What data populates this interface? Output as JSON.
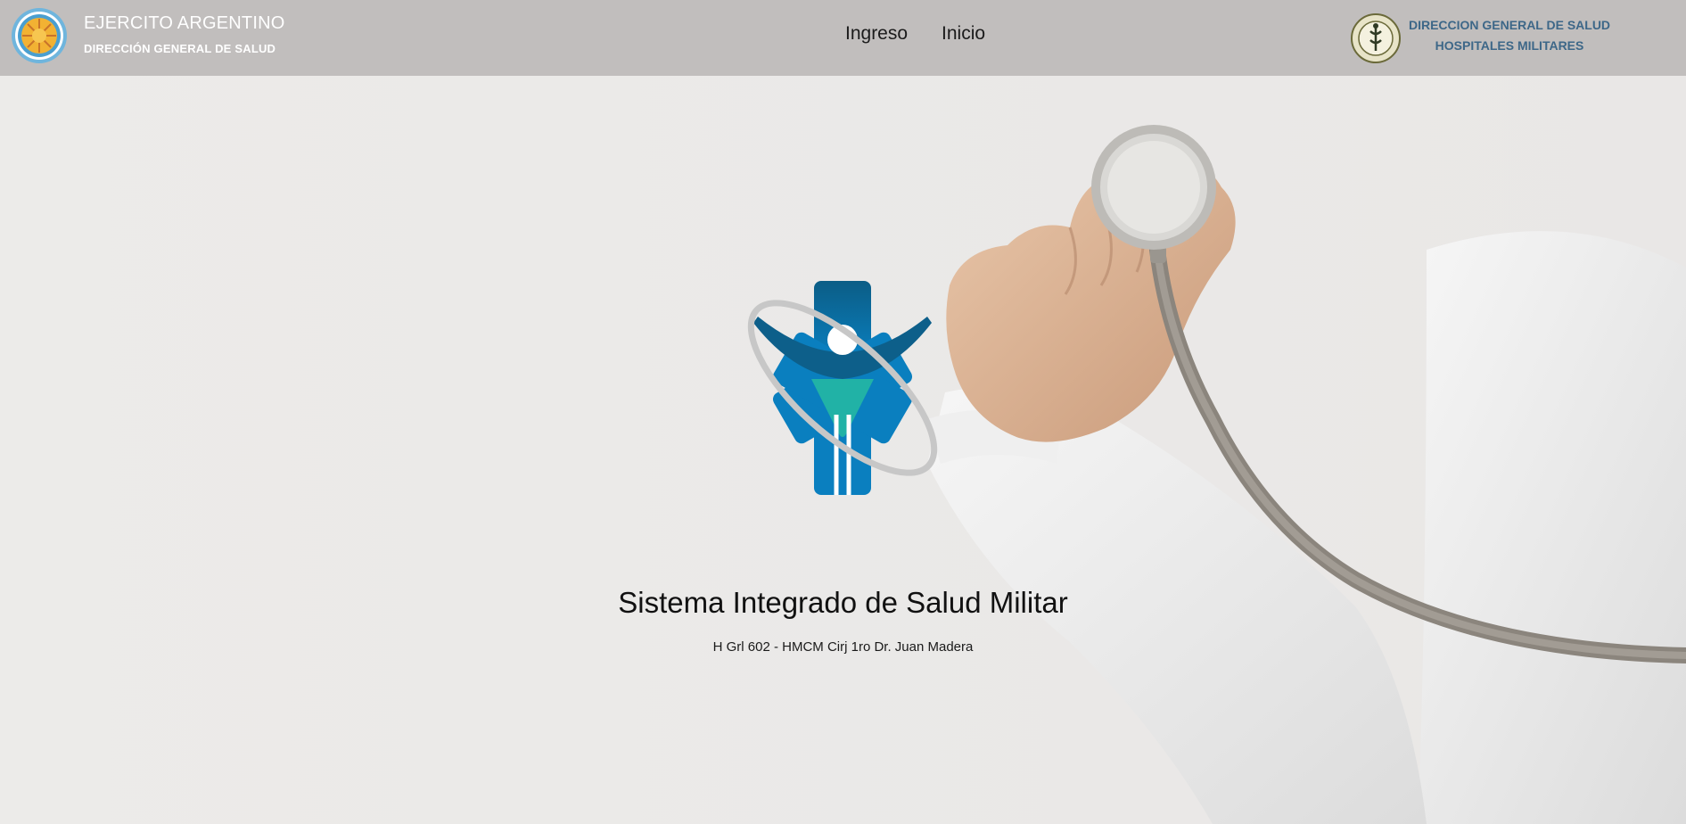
{
  "navbar": {
    "brand_title": "EJERCITO ARGENTINO",
    "brand_subtitle": "DIRECCIÓN GENERAL DE SALUD",
    "links": [
      {
        "label": "Ingreso"
      },
      {
        "label": "Inicio"
      }
    ],
    "right_line1": "DIRECCION GENERAL DE SALUD",
    "right_line2": "HOSPITALES MILITARES"
  },
  "hero": {
    "title": "Sistema Integrado de Salud Militar",
    "subtitle": "H Grl 602 - HMCM Cirj 1ro Dr. Juan Madera"
  },
  "icons": {
    "left_emblem": "army-emblem-icon",
    "right_emblem": "hospital-crest-icon",
    "center_logo": "medical-star-person-icon",
    "background": "doctor-stethoscope-photo"
  },
  "colors": {
    "navbar_bg": "#c1bebd",
    "right_text": "#3d6788",
    "logo_blue": "#0a7fbf",
    "logo_teal": "#21b2a6",
    "logo_dark_blue": "#0b5d86"
  }
}
